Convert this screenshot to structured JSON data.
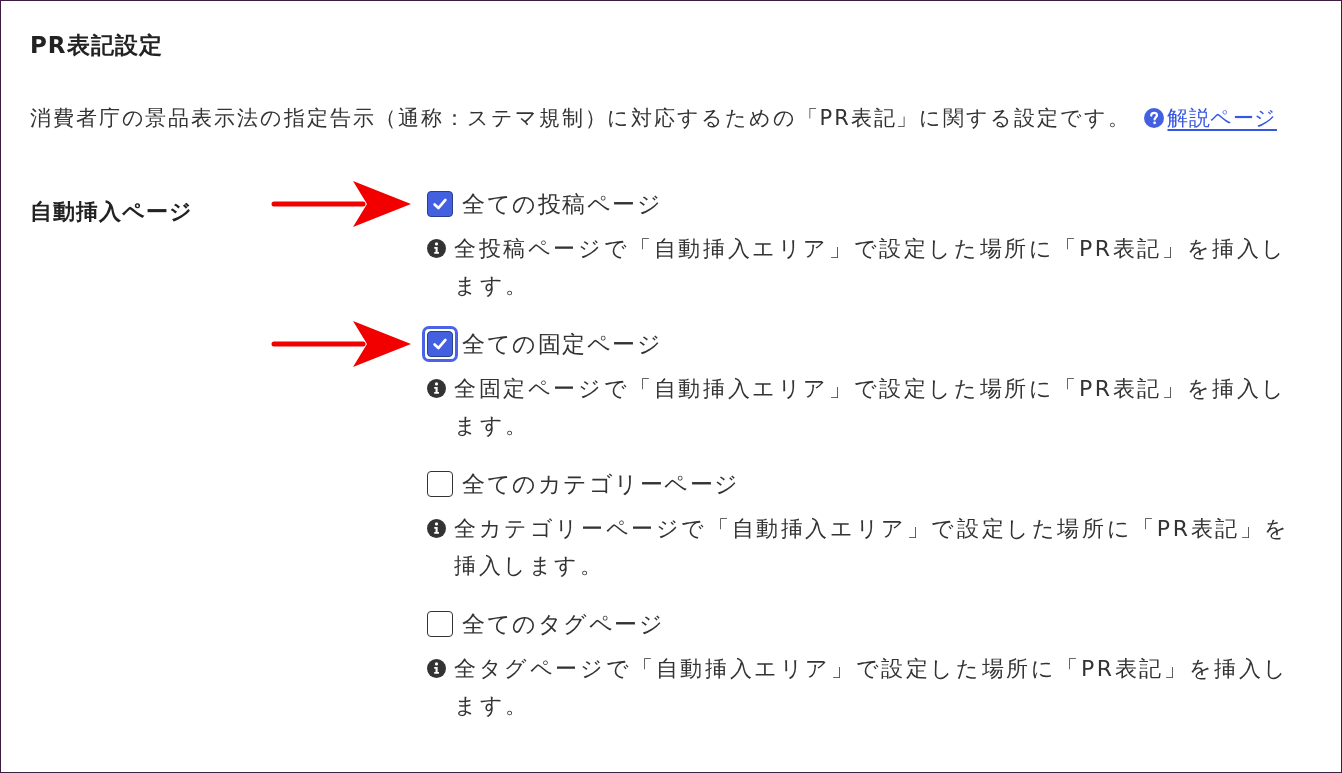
{
  "section": {
    "title": "PR表記設定",
    "description": "消費者庁の景品表示法の指定告示（通称：ステマ規制）に対応するための「PR表記」に関する設定です。",
    "help_link": "解説ページ"
  },
  "auto_insert": {
    "label": "自動挿入ページ",
    "options": [
      {
        "label": "全ての投稿ページ",
        "checked": true,
        "focused": false,
        "arrow": true,
        "note": "全投稿ページで「自動挿入エリア」で設定した場所に「PR表記」を挿入します。"
      },
      {
        "label": "全ての固定ページ",
        "checked": true,
        "focused": true,
        "arrow": true,
        "note": "全固定ページで「自動挿入エリア」で設定した場所に「PR表記」を挿入します。"
      },
      {
        "label": "全てのカテゴリーページ",
        "checked": false,
        "focused": false,
        "arrow": false,
        "note": "全カテゴリーページで「自動挿入エリア」で設定した場所に「PR表記」を挿入します。"
      },
      {
        "label": "全てのタグページ",
        "checked": false,
        "focused": false,
        "arrow": false,
        "note": "全タグページで「自動挿入エリア」で設定した場所に「PR表記」を挿入します。"
      }
    ]
  }
}
